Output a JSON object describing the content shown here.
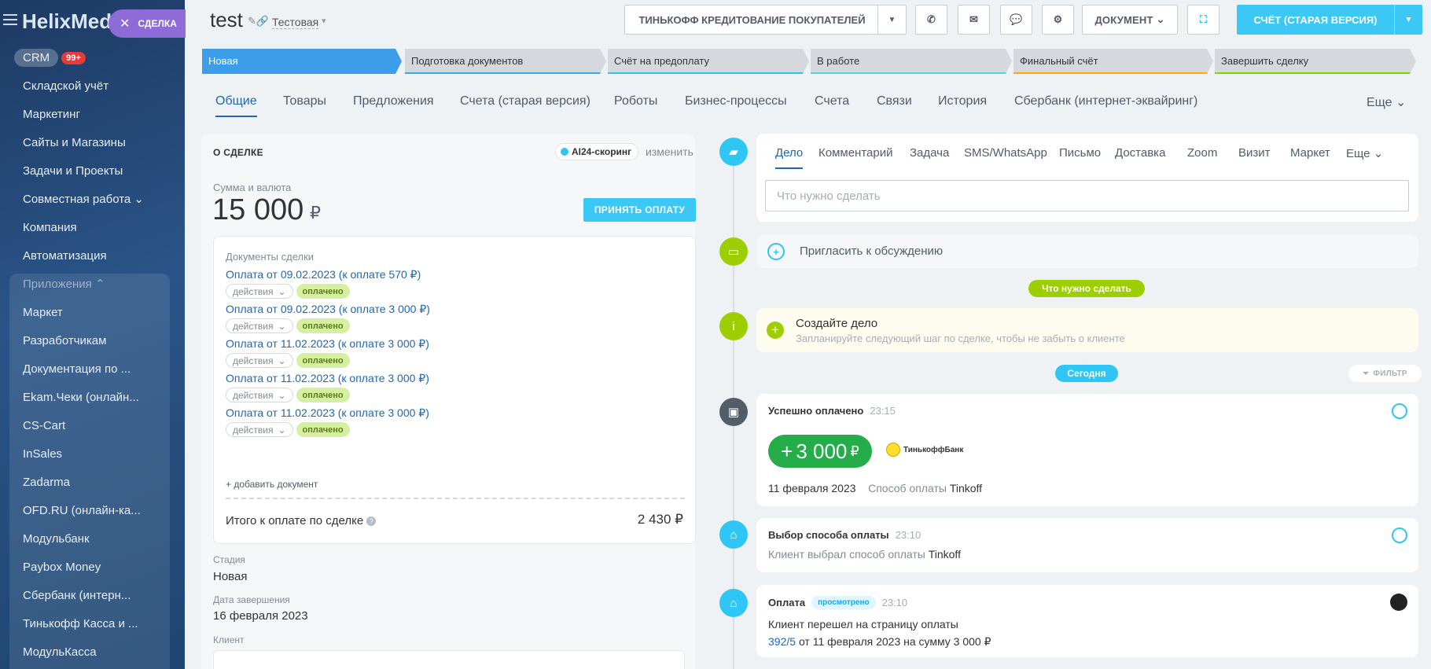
{
  "sidebar": {
    "logo": "HelixMedi",
    "deal_pill": "СДЕЛКА",
    "crm_label": "CRM",
    "crm_badge": "99+",
    "items": [
      "Складской учёт",
      "Маркетинг",
      "Сайты и Магазины",
      "Задачи и Проекты",
      "Совместная работа",
      "Компания",
      "Автоматизация",
      "Приложения",
      "Маркет",
      "Разработчикам",
      "Документация по ...",
      "Ekam.Чеки (онлайн...",
      "CS-Cart",
      "InSales",
      "Zadarma",
      "OFD.RU (онлайн-ка...",
      "Модульбанк",
      "Paybox Money",
      "Сбербанк (интерн...",
      "Тинькофф Касса и ...",
      "МодульКасса"
    ]
  },
  "header": {
    "title": "test",
    "category": "Тестовая",
    "btn_tinkoff": "ТИНЬКОФФ КРЕДИТОВАНИЕ ПОКУПАТЕЛЕЙ",
    "btn_document": "ДОКУМЕНТ",
    "btn_invoice": "СЧЁТ (СТАРАЯ ВЕРСИЯ)"
  },
  "stages": [
    {
      "label": "Новая",
      "color": "#3c9ee8"
    },
    {
      "label": "Подготовка документов",
      "color": "#39a8ef"
    },
    {
      "label": "Счёт на предоплату",
      "color": "#2fc6f6"
    },
    {
      "label": "В работе",
      "color": "#55d0e0"
    },
    {
      "label": "Финальный счёт",
      "color": "#ffa900"
    },
    {
      "label": "Завершить сделку",
      "color": "#7bd500"
    }
  ],
  "tabs": [
    "Общие",
    "Товары",
    "Предложения",
    "Счета (старая версия)",
    "Роботы",
    "Бизнес-процессы",
    "Счета",
    "Связи",
    "История",
    "Сбербанк (интернет-эквайринг)",
    "Еще"
  ],
  "deal": {
    "section_title": "О СДЕЛКЕ",
    "ai_badge": "AI24-скоринг",
    "change": "изменить",
    "sum_label": "Сумма и валюта",
    "sum": "15 000",
    "currency": "₽",
    "pay_button": "ПРИНЯТЬ ОПЛАТУ",
    "docs_label": "Документы сделки",
    "docs": [
      {
        "title": "Оплата от 09.02.2023 (к оплате 570 ₽)",
        "actions": "действия",
        "status": "оплачено"
      },
      {
        "title": "Оплата от 09.02.2023 (к оплате 3 000 ₽)",
        "actions": "действия",
        "status": "оплачено"
      },
      {
        "title": "Оплата от 11.02.2023 (к оплате 3 000 ₽)",
        "actions": "действия",
        "status": "оплачено"
      },
      {
        "title": "Оплата от 11.02.2023 (к оплате 3 000 ₽)",
        "actions": "действия",
        "status": "оплачено"
      },
      {
        "title": "Оплата от 11.02.2023 (к оплате 3 000 ₽)",
        "actions": "действия",
        "status": "оплачено"
      }
    ],
    "add_doc": "+ добавить документ",
    "total_label": "Итого к оплате по сделке",
    "total_value": "2 430 ₽",
    "stage_label": "Стадия",
    "stage_value": "Новая",
    "close_label": "Дата завершения",
    "close_value": "16 февраля 2023",
    "client_label": "Клиент"
  },
  "activity": {
    "tabs": [
      "Дело",
      "Комментарий",
      "Задача",
      "SMS/WhatsApp",
      "Письмо",
      "Доставка",
      "Zoom",
      "Визит",
      "Маркет",
      "Еще"
    ],
    "input_placeholder": "Что нужно сделать",
    "invite": "Пригласить к обсуждению",
    "todo_pill": "Что нужно сделать",
    "create_title": "Создайте дело",
    "create_sub": "Запланируйте следующий шаг по сделке, чтобы не забыть о клиенте",
    "today_pill": "Сегодня",
    "filter": "ФИЛЬТР"
  },
  "events": {
    "paid": {
      "title": "Успешно оплачено",
      "time": "23:15",
      "amount": "3 000",
      "plus": "+",
      "currency": "₽",
      "bank": "ТинькоффБанк",
      "date": "11 февраля 2023",
      "method_label": "Способ оплаты",
      "method": "Tinkoff"
    },
    "choice": {
      "title": "Выбор способа оплаты",
      "time": "23:10",
      "text": "Клиент выбрал способ оплаты",
      "method": "Tinkoff"
    },
    "payment": {
      "title": "Оплата",
      "badge": "просмотрено",
      "time": "23:10",
      "line1": "Клиент перешел на страницу оплаты",
      "link": "392/5",
      "line2": "от 11 февраля 2023 на сумму 3 000 ₽"
    }
  },
  "colors": {
    "accent": "#2067b0",
    "primary": "#3bc8f5",
    "success": "#25ad49",
    "green_icon": "#9dcf00",
    "sidebar": "#1d3a63"
  }
}
